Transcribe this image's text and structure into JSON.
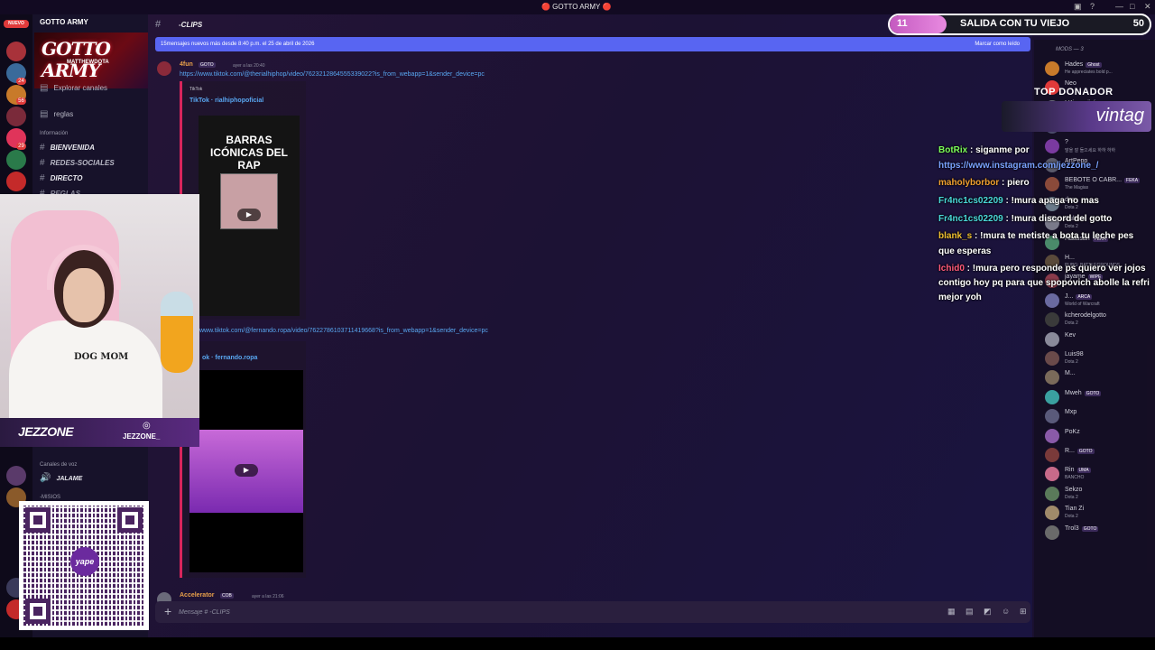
{
  "window": {
    "title": "🔴 GOTTO ARMY 🔴"
  },
  "server_rail": {
    "badge_new": "NUEVO",
    "counts": [
      "24",
      "56",
      "29"
    ]
  },
  "sidebar": {
    "server_name": "GOTTO ARMY",
    "banner_title": "GOTTO ARMY",
    "banner_sub": "MATTHEWDOTA",
    "explore": "Explorar canales",
    "rules": "reglas",
    "category_info": "Información",
    "channels": [
      "BIENVENIDA",
      "REDES-SOCIALES",
      "DIRECTO",
      "REGLAS"
    ],
    "voice_category": "Canales de voz",
    "voice_channel": "JALAME",
    "misc_category": "-MISIOS"
  },
  "webcam": {
    "name": "JEZZONE",
    "ig_handle": "JEZZONE_",
    "shirt": "DOG MOM"
  },
  "qr": {
    "logo": "yape"
  },
  "channel": {
    "name": "-CLIPS",
    "new_messages": "15mensajes nuevos más desde 8:40 p.m. el 25 de abril de 2026",
    "mark_read": "Marcar como leído"
  },
  "messages": [
    {
      "author": "4fun",
      "tag": "GOTO",
      "time": "ayer a las 20:40",
      "link": "https://www.tiktok.com/@therialhiphop/video/7623212864555339022?is_from_webapp=1&sender_device=pc",
      "embed_provider": "TikTok",
      "embed_title": "TikTok · rialhiphopoficial",
      "thumb_title": "BARRAS ICÓNICAS DEL RAP"
    },
    {
      "link": "www.tiktok.com/@fernando.ropa/video/7622786103711419668?is_from_webapp=1&sender_device=pc",
      "embed_title": "ok · fernando.ropa"
    },
    {
      "author": "Accelerator",
      "tag": "COB",
      "time": "ayer a las 21:06"
    }
  ],
  "composer": {
    "placeholder": "Mensaje # -CLIPS"
  },
  "goal": {
    "current": "11",
    "title": "SALIDA CON TU VIEJO",
    "target": "50",
    "progress": 0.22
  },
  "top_donor": {
    "label": "TOP DONADOR",
    "name": "vintag"
  },
  "overlay_chat": [
    {
      "user": "BotRix",
      "text": "siganme por",
      "color": "#7cfc5a"
    },
    {
      "user": "",
      "text": "https://www.instagram.com/jezzone_/",
      "color": "#7aa2ff"
    },
    {
      "user": "maholyborbor",
      "text": "piero",
      "color": "#f0a030"
    },
    {
      "user": "Fr4nc1cs02209",
      "text": "!mura apaga no mas",
      "color": "#4ad9d9"
    },
    {
      "user": "Fr4nc1cs02209",
      "text": "!mura discord del gotto",
      "color": "#4ad9d9"
    },
    {
      "user": "blank_s",
      "text": "!mura te metiste a bota tu leche pes",
      "color": "#f0c030"
    },
    {
      "user": "",
      "text": "que esperas",
      "color": "#ffffff"
    },
    {
      "user": "Ichid0",
      "text": "!mura pero responde ps quiero ver jojos",
      "color": "#ff5a7a"
    },
    {
      "user": "",
      "text": "contigo hoy pq para que spopovich abolle la refri",
      "color": "#ffffff"
    },
    {
      "user": "",
      "text": "mejor yoh",
      "color": "#ffffff"
    }
  ],
  "members": {
    "header": "MODS — 3",
    "list": [
      {
        "name": "Hades",
        "status": "He appreciates bold p...",
        "badge": "Ghost"
      },
      {
        "name": "Neo",
        "status": "",
        "badge": ""
      },
      {
        "name": "! Kim sajiró",
        "status": "VALORANT",
        "badge": "GOTO"
      },
      {
        "name": "!imEmperor",
        "status": "",
        "badge": "GOTO"
      },
      {
        "name": "?",
        "status": "말을 잘 들으세요 하하 하하",
        "badge": ""
      },
      {
        "name": "ArtPepp",
        "status": "",
        "badge": ""
      },
      {
        "name": "BEBOTE O CABR...",
        "status": "The Magias",
        "badge": "FEKA"
      },
      {
        "name": "dsa",
        "status": "Dota 2",
        "badge": ""
      },
      {
        "name": "Dubfire",
        "status": "Dota 2",
        "badge": ""
      },
      {
        "name": "Haassan",
        "status": "",
        "badge": "FEKA"
      },
      {
        "name": "H...",
        "status": "PUBG: BATTLEGROUNDS",
        "badge": ""
      },
      {
        "name": "jayame",
        "status": "",
        "badge": "WIPE"
      },
      {
        "name": "J...",
        "status": "World of Warcraft",
        "badge": "ARCA"
      },
      {
        "name": "kcherodelgotto",
        "status": "Dota 2",
        "badge": ""
      },
      {
        "name": "Kev",
        "status": "",
        "badge": ""
      },
      {
        "name": "Luis98",
        "status": "Dota 2",
        "badge": ""
      },
      {
        "name": "M...",
        "status": "",
        "badge": ""
      },
      {
        "name": "Mweh",
        "status": "",
        "badge": "GOTO"
      },
      {
        "name": "Mxp",
        "status": "",
        "badge": ""
      },
      {
        "name": "PoKz",
        "status": "",
        "badge": ""
      },
      {
        "name": "R...",
        "status": "",
        "badge": "GOTO"
      },
      {
        "name": "Rin",
        "status": "BANCHO",
        "badge": "UMA"
      },
      {
        "name": "Sekzo",
        "status": "Dota 2",
        "badge": ""
      },
      {
        "name": "Tian Zi",
        "status": "Dota 2",
        "badge": ""
      },
      {
        "name": "Trol3",
        "status": "",
        "badge": "GOTO"
      }
    ]
  }
}
